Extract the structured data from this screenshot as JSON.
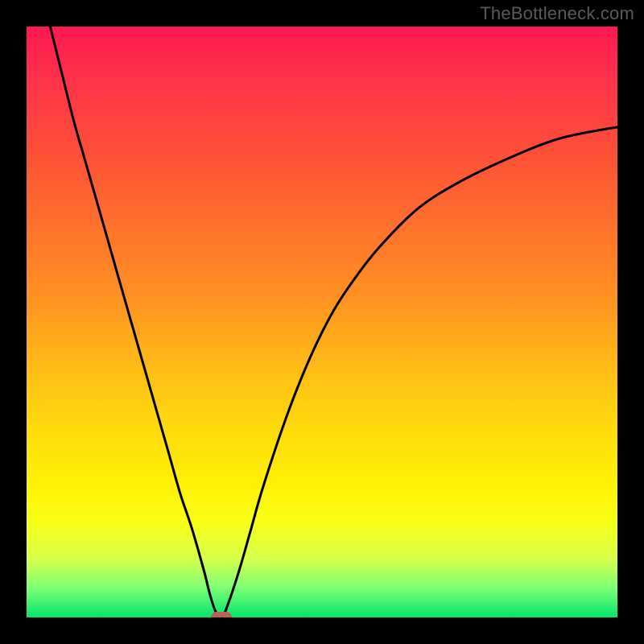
{
  "watermark": "TheBottleneck.com",
  "colors": {
    "page_bg": "#000000",
    "gradient_top": "#ff1852",
    "gradient_bottom": "#00e56b",
    "curve": "#000000",
    "marker": "#bb6255",
    "watermark": "#5a5a5a"
  },
  "chart_data": {
    "type": "line",
    "title": "",
    "xlabel": "",
    "ylabel": "",
    "xlim": [
      0,
      100
    ],
    "ylim": [
      0,
      100
    ],
    "grid": false,
    "legend": false,
    "note": "Bottleneck-style V-curve. x is normalized component balance; y is mismatch (0 at minimum). Background gradient encodes y: red=high, green=low. Values estimated from pixels.",
    "series": [
      {
        "name": "mismatch-curve",
        "x": [
          4,
          6,
          8,
          10,
          12,
          14,
          16,
          18,
          20,
          22,
          24,
          26,
          28,
          30,
          31,
          32,
          33,
          34,
          36,
          38,
          40,
          44,
          48,
          52,
          56,
          60,
          66,
          72,
          80,
          90,
          100
        ],
        "y": [
          100,
          92,
          84,
          77,
          70,
          63,
          56,
          49,
          42,
          35,
          28,
          21,
          15,
          8,
          4,
          1,
          0,
          2,
          8,
          15,
          22,
          34,
          44,
          52,
          58,
          63,
          69,
          73,
          77,
          81,
          83
        ]
      }
    ],
    "marker": {
      "x": 33,
      "y": 0
    }
  }
}
